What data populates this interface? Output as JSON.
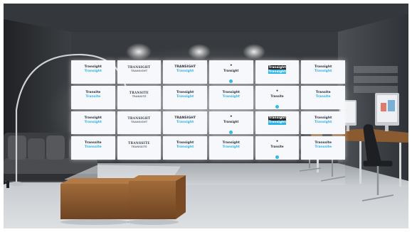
{
  "scene": {
    "description_free": true,
    "colors": {
      "wall_dark": "#2a2d31",
      "floor": "#cfd3d7",
      "tile": "#f7f8fb",
      "logo_dark": "#2f3540",
      "logo_accent": "#2fb3e6",
      "wood": "#8a5a30"
    }
  },
  "logo_wall": {
    "rows": [
      [
        {
          "style": "plain",
          "line1": "Transight",
          "line2": "Transight"
        },
        {
          "style": "serif",
          "line1": "TRANSIGHT",
          "line2": "TRANSIGHT"
        },
        {
          "style": "plain",
          "line1": "TRANSIGHT",
          "line2": "Transight"
        },
        {
          "style": "dot",
          "line1": "•",
          "line2": "Transight"
        },
        {
          "style": "boxed",
          "line1": "Transight",
          "line2": "Transight"
        },
        {
          "style": "plain",
          "line1": "Transight",
          "line2": "Transight"
        }
      ],
      [
        {
          "style": "plain",
          "line1": "Transite",
          "line2": "Transite"
        },
        {
          "style": "serif",
          "line1": "TRANSITE",
          "line2": "TRANSITE"
        },
        {
          "style": "plain",
          "line1": "Transight",
          "line2": "Transight"
        },
        {
          "style": "plain",
          "line1": "Transight",
          "line2": "Transight"
        },
        {
          "style": "dot",
          "line1": "•",
          "line2": "Transite"
        },
        {
          "style": "plain",
          "line1": "Transite",
          "line2": "Transite"
        }
      ],
      [
        {
          "style": "plain",
          "line1": "Transight",
          "line2": "Transight"
        },
        {
          "style": "serif",
          "line1": "TRANSIGHT",
          "line2": "TRANSIGHT"
        },
        {
          "style": "plain",
          "line1": "TRANSIGHT",
          "line2": "Transight"
        },
        {
          "style": "dot",
          "line1": "•",
          "line2": "Transight"
        },
        {
          "style": "boxed",
          "line1": "Transight",
          "line2": "Transight"
        },
        {
          "style": "plain",
          "line1": "Transight",
          "line2": "Transight"
        }
      ],
      [
        {
          "style": "plain",
          "line1": "Transsite",
          "line2": "Transsite"
        },
        {
          "style": "serif",
          "line1": "TRANSSITE",
          "line2": "TRANSSITE"
        },
        {
          "style": "plain",
          "line1": "Transight",
          "line2": "Transight"
        },
        {
          "style": "plain",
          "line1": "Transight",
          "line2": "Transight"
        },
        {
          "style": "dot",
          "line1": "•",
          "line2": "Transite"
        },
        {
          "style": "plain",
          "line1": "Transsite",
          "line2": "Transsite"
        }
      ]
    ]
  }
}
